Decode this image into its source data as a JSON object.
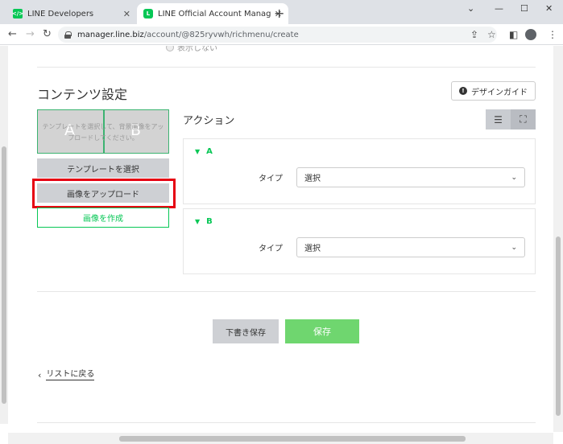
{
  "browser": {
    "tabs": [
      {
        "title": "LINE Developers",
        "favicon": "line-developers-icon"
      },
      {
        "title": "LINE Official Account Manager",
        "favicon": "line-oa-icon"
      }
    ],
    "url_host": "manager.line.biz",
    "url_path": "/account/@825ryvwh/richmenu/create"
  },
  "page": {
    "prev_option": "表示しない",
    "section_title": "コンテンツ設定",
    "design_guide": "デザインガイド",
    "preview": {
      "area_a": "A",
      "area_b": "B",
      "hint": "テンプレートを選択して、背景画像をアップロードしてください。"
    },
    "buttons": {
      "select_template": "テンプレートを選択",
      "upload_image": "画像をアップロード",
      "create_image": "画像を作成",
      "save_draft": "下書き保存",
      "save": "保存"
    },
    "actions_title": "アクション",
    "actions": [
      {
        "label": "A",
        "type_label": "タイプ",
        "type_value": "選択"
      },
      {
        "label": "B",
        "type_label": "タイプ",
        "type_value": "選択"
      }
    ],
    "back_link": "リストに戻る"
  },
  "colors": {
    "line_green": "#06c755",
    "save_green": "#6fd66f",
    "highlight_red": "#e60012",
    "button_gray": "#ced0d4"
  }
}
